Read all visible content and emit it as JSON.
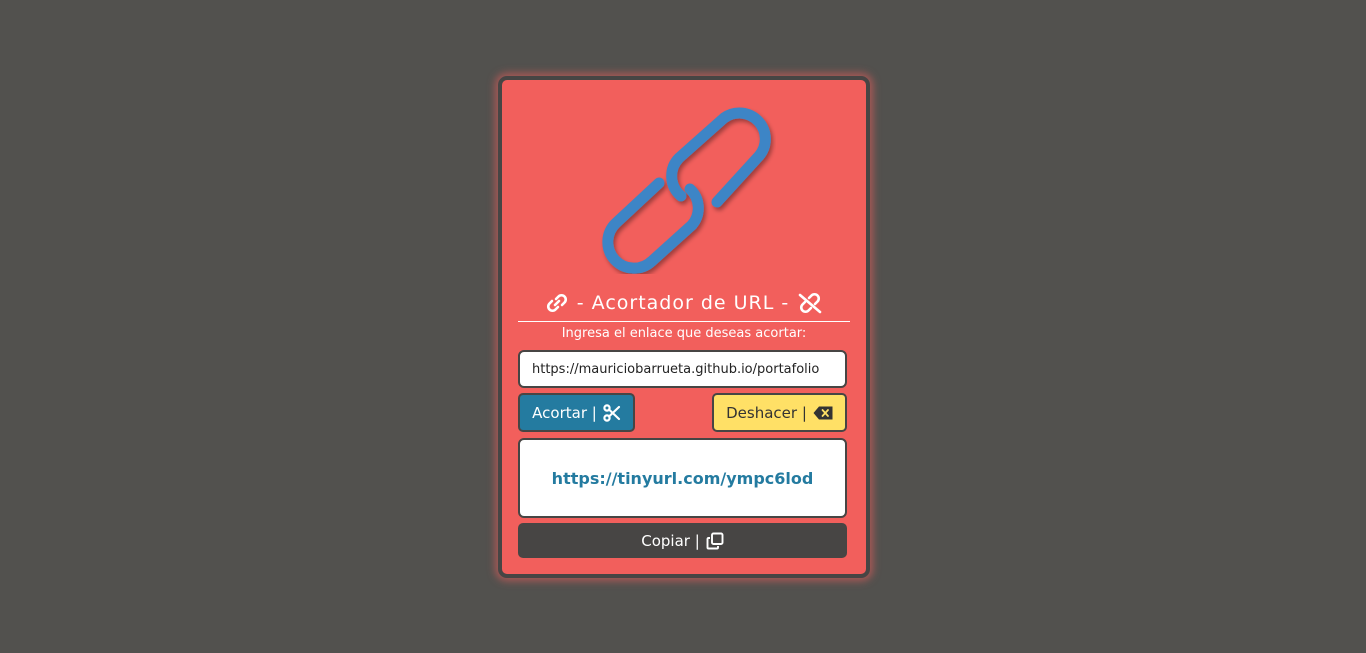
{
  "app": {
    "title": "- Acortador de URL -",
    "subtitle": "Ingresa el enlace que deseas acortar:"
  },
  "input": {
    "value": "https://mauriciobarrueta.github.io/portafolio",
    "placeholder": ""
  },
  "buttons": {
    "shorten_label": "Acortar |",
    "undo_label": "Deshacer |",
    "copy_label": "Copiar |"
  },
  "result": {
    "short_url": "https://tinyurl.com/ympc6lod"
  },
  "icons": {
    "logo": "link-icon",
    "title_left": "link-icon",
    "title_right": "unlink-icon",
    "shorten": "scissors-icon",
    "undo": "backspace-icon",
    "copy": "copy-icon"
  },
  "colors": {
    "background": "#52514e",
    "card": "#f25f5c",
    "border": "#474544",
    "logo": "#3d85c6",
    "shorten_button": "#247ba0",
    "undo_button": "#ffe066",
    "link_text": "#247ba0"
  }
}
